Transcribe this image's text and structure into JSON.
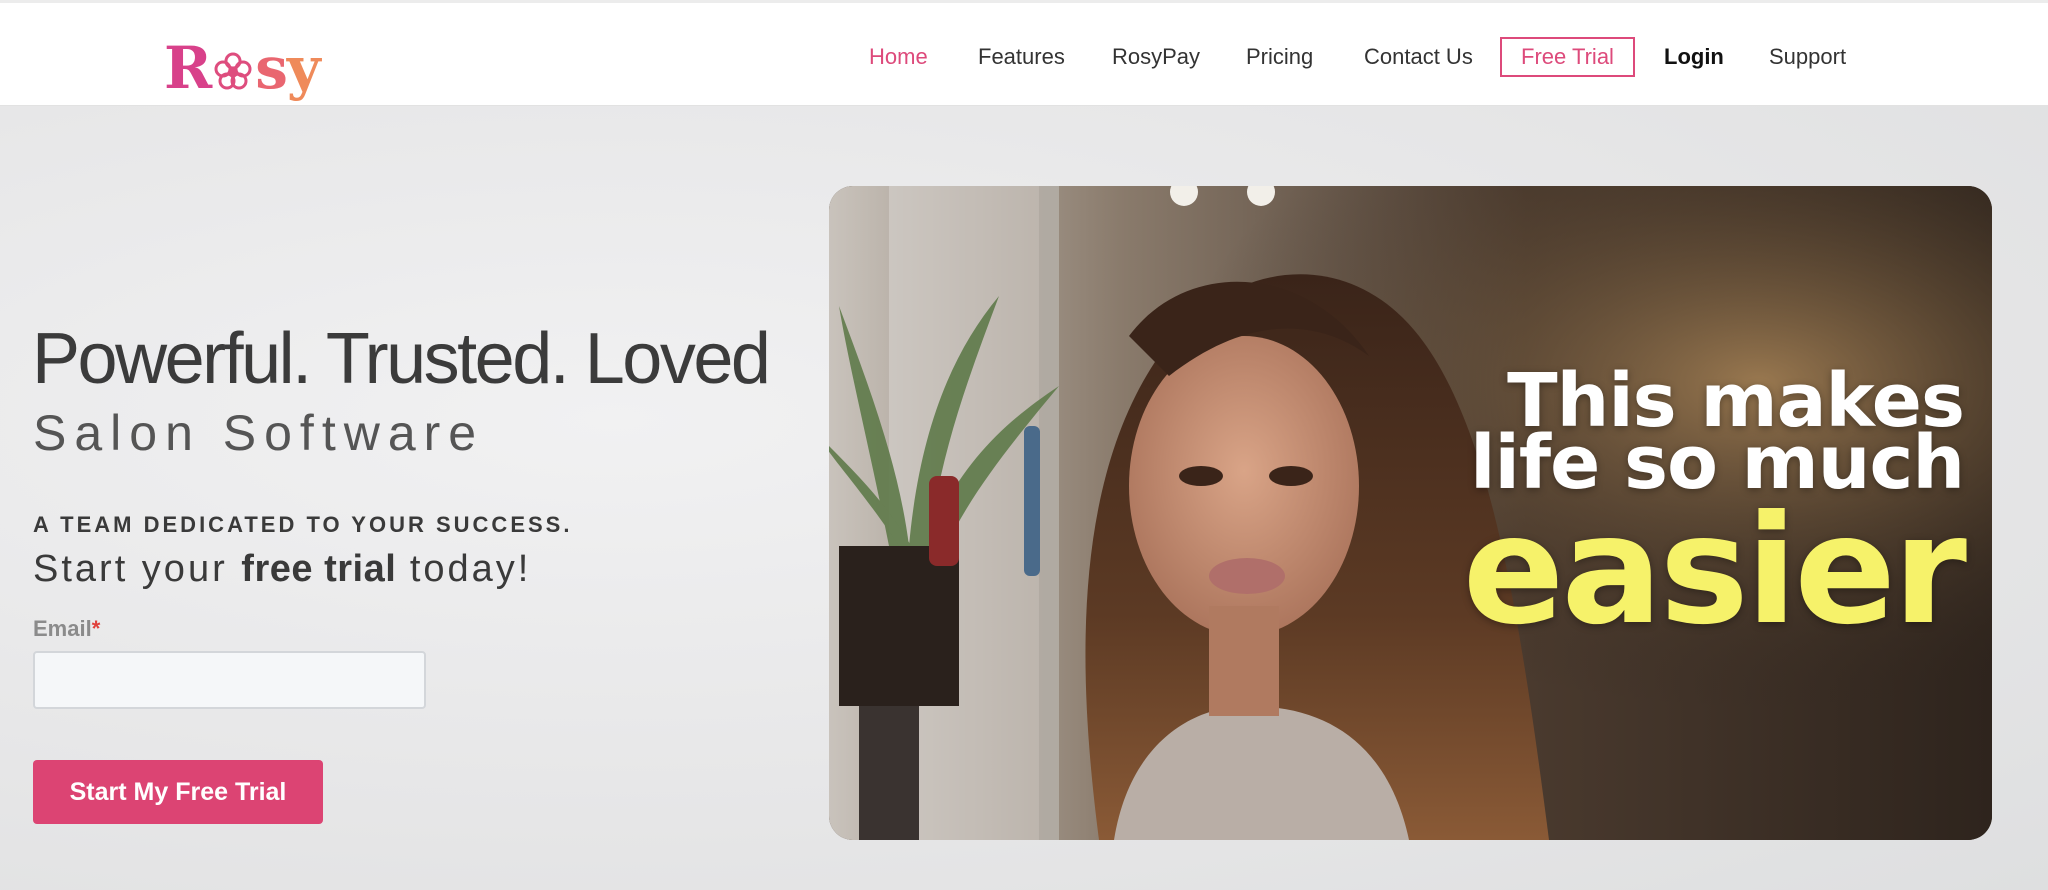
{
  "brand": {
    "logo_text": "Rosy",
    "colors": {
      "accent": "#dc4473",
      "nav_active": "#dd4a7b",
      "highlight_yellow": "#f6f26a"
    }
  },
  "nav": {
    "items": [
      {
        "label": "Home",
        "active": true
      },
      {
        "label": "Features"
      },
      {
        "label": "RosyPay"
      },
      {
        "label": "Pricing"
      },
      {
        "label": "Contact Us"
      },
      {
        "label": "Free Trial",
        "style": "outlined"
      },
      {
        "label": "Login",
        "style": "bold"
      },
      {
        "label": "Support"
      }
    ]
  },
  "hero": {
    "headline": "Powerful. Trusted. Loved",
    "subheadline": "Salon Software",
    "tagline": "A TEAM DEDICATED TO YOUR SUCCESS.",
    "trial_prefix": "Start your ",
    "trial_bold": "free trial",
    "trial_suffix": " today!",
    "email_label": "Email",
    "email_required_mark": "*",
    "email_value": "",
    "cta_label": "Start My Free Trial"
  },
  "video": {
    "overlay_line1": "This makes",
    "overlay_line2": "life so much",
    "overlay_line3": "easier"
  }
}
